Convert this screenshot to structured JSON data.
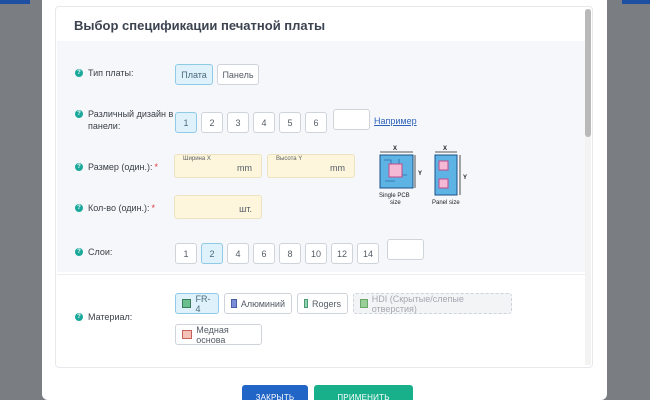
{
  "dialog": {
    "title": "Выбор спецификации печатной платы",
    "rows": {
      "board_type": {
        "label": "Тип платы:",
        "options": [
          "Плата",
          "Панель"
        ]
      },
      "designs": {
        "label_line1": "Различный дизайн в",
        "label_line2": "панели:",
        "options": [
          "1",
          "2",
          "3",
          "4",
          "5",
          "6"
        ],
        "example_link": "Например"
      },
      "size": {
        "label": "Размер (один.):",
        "required_mark": "*",
        "width_tag": "Ширина X",
        "height_tag": "Высота Y",
        "unit": "mm",
        "diagram": {
          "single_caption_1": "Single PCB",
          "single_caption_2": "size",
          "panel_caption": "Panel size",
          "axis_x": "X",
          "axis_y": "Y"
        }
      },
      "quantity": {
        "label": "Кол-во (один.):",
        "required_mark": "*",
        "unit": "шт."
      },
      "layers": {
        "label": "Слои:",
        "options": [
          "1",
          "2",
          "4",
          "6",
          "8",
          "10",
          "12",
          "14"
        ]
      },
      "material": {
        "label": "Материал:",
        "options": [
          "FR-4",
          "Алюминий",
          "Rogers",
          "HDI (Скрытые/слепые отверстия)",
          "Медная основа"
        ]
      }
    },
    "buttons": {
      "close": "ЗАКРЫТЬ",
      "apply": "ПРИМЕНИТЬ"
    }
  },
  "colors": {
    "accent_teal": "#1aa89b",
    "selected_bg": "#dff2fb",
    "input_bg": "#fdf6dc",
    "close_button": "#2166c7",
    "apply_button": "#18b08a",
    "required": "#e0383e"
  }
}
